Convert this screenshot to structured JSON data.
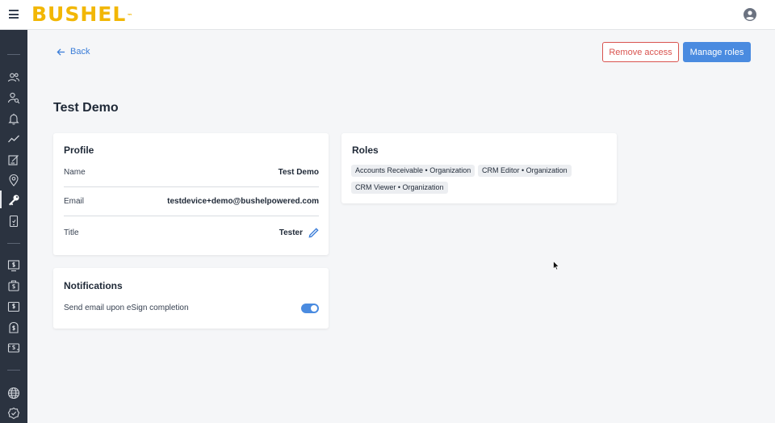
{
  "header": {
    "logo_text": "BUSHEL",
    "logo_mark": "™",
    "menu_icon": "hamburger-icon",
    "account_icon": "account-circle-icon"
  },
  "sidebar": {
    "items": [
      {
        "icon": "users-group-icon"
      },
      {
        "icon": "user-search-icon"
      },
      {
        "icon": "bell-icon"
      },
      {
        "icon": "trend-line-icon"
      },
      {
        "icon": "edit-form-icon"
      },
      {
        "icon": "location-pin-icon"
      },
      {
        "icon": "key-icon",
        "active": true
      },
      {
        "icon": "mobile-device-icon"
      },
      {
        "icon": "money-display-icon"
      },
      {
        "icon": "money-bag-icon"
      },
      {
        "icon": "money-card-icon"
      },
      {
        "icon": "money-safe-icon"
      },
      {
        "icon": "money-transfer-icon"
      },
      {
        "icon": "globe-icon"
      },
      {
        "icon": "check-badge-icon"
      }
    ]
  },
  "actions": {
    "back_label": "Back",
    "remove_access_label": "Remove access",
    "manage_roles_label": "Manage roles"
  },
  "page": {
    "title": "Test Demo"
  },
  "profile": {
    "heading": "Profile",
    "name_label": "Name",
    "name_value": "Test Demo",
    "email_label": "Email",
    "email_value": "testdevice+demo@bushelpowered.com",
    "title_label": "Title",
    "title_value": "Tester"
  },
  "notifications": {
    "heading": "Notifications",
    "esign_label": "Send email upon eSign completion",
    "esign_enabled": true
  },
  "roles": {
    "heading": "Roles",
    "items": [
      "Accounts Receivable • Organization",
      "CRM Editor • Organization",
      "CRM Viewer • Organization"
    ]
  },
  "colors": {
    "brand_yellow": "#f2b705",
    "sidebar_bg": "#2b3340",
    "primary_blue": "#4a8be0",
    "danger_red": "#d9534f"
  }
}
